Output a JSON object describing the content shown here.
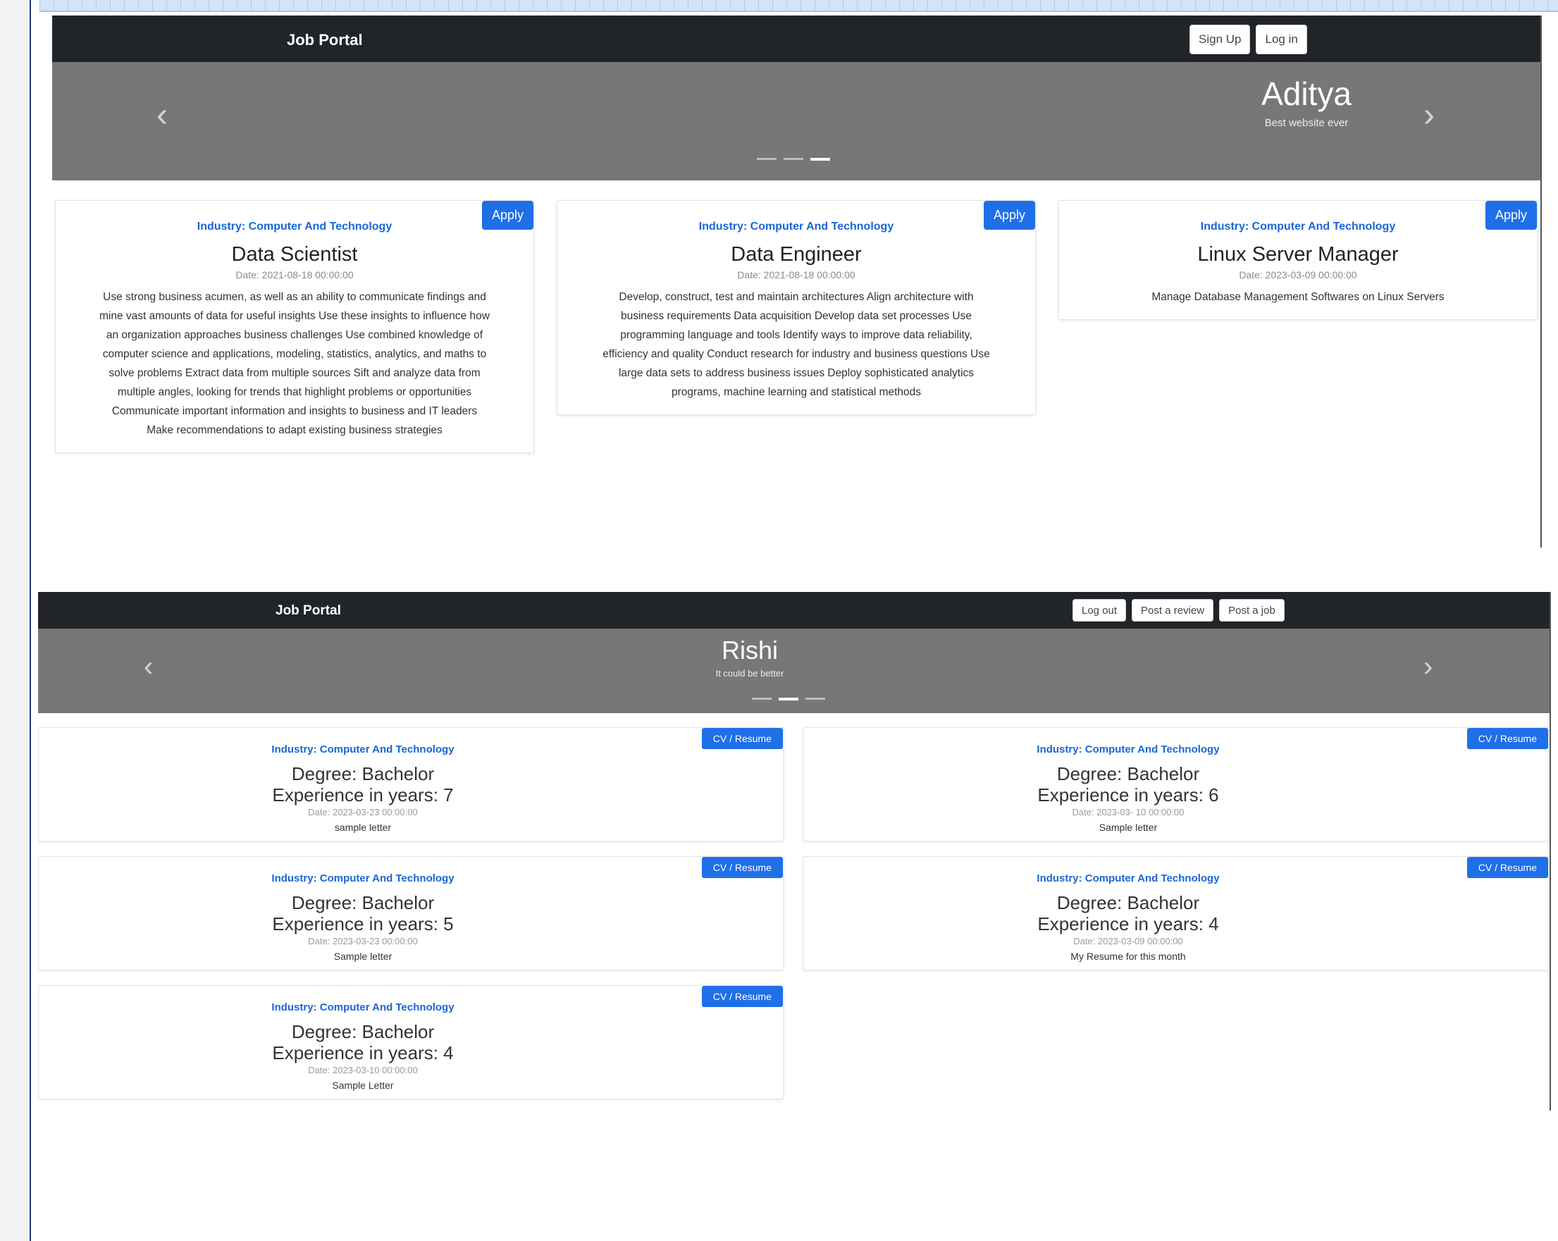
{
  "screen1": {
    "brand": "Job Portal",
    "nav_buttons": [
      "Sign Up",
      "Log in"
    ],
    "carousel": {
      "prev_icon": "‹",
      "next_icon": "›",
      "title": "Aditya",
      "subtitle": "Best website ever",
      "indicator_count": 3,
      "active_indicator": 2
    },
    "jobs": [
      {
        "industry": "Industry: Computer And Technology",
        "title": "Data Scientist",
        "date": "Date: 2021-08-18 00:00:00",
        "description": "Use strong business acumen, as well as an ability to communicate findings and mine vast amounts of data for useful insights Use these insights to influence how an organization approaches business challenges Use combined knowledge of computer science and applications, modeling, statistics, analytics, and maths to solve problems Extract data from multiple sources Sift and analyze data from multiple angles, looking for trends that highlight problems or opportunities Communicate important information and insights to business and IT leaders Make recommendations to adapt existing business strategies",
        "apply_label": "Apply"
      },
      {
        "industry": "Industry: Computer And Technology",
        "title": "Data Engineer",
        "date": "Date: 2021-08-18 00:00:00",
        "description": "Develop, construct, test and maintain architectures Align architecture with business requirements Data acquisition Develop data set processes Use programming language and tools Identify ways to improve data reliability, efficiency and quality Conduct research for industry and business questions Use large data sets to address business issues Deploy sophisticated analytics programs, machine learning and statistical methods",
        "apply_label": "Apply"
      },
      {
        "industry": "Industry: Computer And Technology",
        "title": "Linux Server Manager",
        "date": "Date: 2023-03-09 00:00:00",
        "description": "Manage Database Management Softwares on Linux Servers",
        "apply_label": "Apply"
      }
    ]
  },
  "screen2": {
    "brand": "Job Portal",
    "nav_buttons": [
      "Log out",
      "Post a review",
      "Post a job"
    ],
    "carousel": {
      "prev_icon": "‹",
      "next_icon": "›",
      "title": "Rishi",
      "subtitle": "It could be better",
      "indicator_count": 3,
      "active_indicator": 1
    },
    "resumes": [
      {
        "industry": "Industry: Computer And Technology",
        "degree": "Degree: Bachelor",
        "experience": "Experience in years: 7",
        "date": "Date: 2023-03-23 00:00:00",
        "letter": "sample letter",
        "button_label": "CV / Resume"
      },
      {
        "industry": "Industry: Computer And Technology",
        "degree": "Degree: Bachelor",
        "experience": "Experience in years: 6",
        "date": "Date: 2023-03- 10 00:00:00",
        "letter": "Sample letter",
        "button_label": "CV / Resume"
      },
      {
        "industry": "Industry: Computer And Technology",
        "degree": "Degree: Bachelor",
        "experience": "Experience in years: 5",
        "date": "Date: 2023-03-23 00:00:00",
        "letter": "Sample letter",
        "button_label": "CV / Resume"
      },
      {
        "industry": "Industry: Computer And Technology",
        "degree": "Degree: Bachelor",
        "experience": "Experience in years: 4",
        "date": "Date: 2023-03-09 00:00:00",
        "letter": "My Resume for this month",
        "button_label": "CV / Resume"
      },
      {
        "industry": "Industry: Computer And Technology",
        "degree": "Degree: Bachelor",
        "experience": "Experience in years: 4",
        "date": "Date: 2023-03-10 00:00:00",
        "letter": "Sample Letter",
        "button_label": "CV / Resume"
      }
    ]
  }
}
